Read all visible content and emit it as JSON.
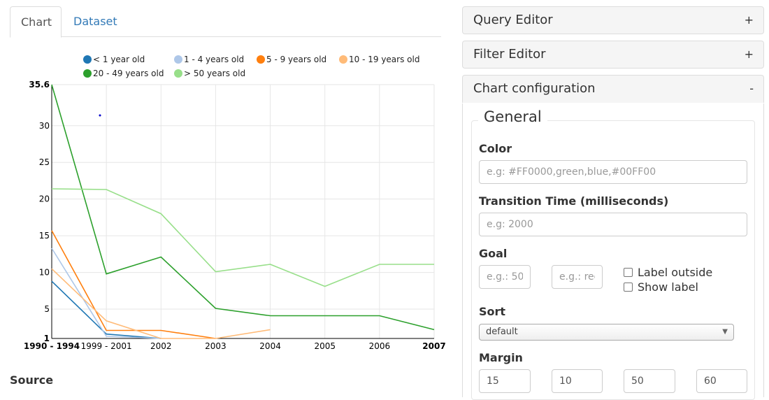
{
  "tabs": [
    {
      "label": "Chart",
      "active": true
    },
    {
      "label": "Dataset",
      "active": false
    }
  ],
  "source": {
    "title": "Source"
  },
  "panels": {
    "query_editor": {
      "title": "Query Editor",
      "toggle": "+"
    },
    "filter_editor": {
      "title": "Filter Editor",
      "toggle": "+"
    },
    "chart_configuration": {
      "title": "Chart configuration",
      "toggle": "-"
    }
  },
  "config": {
    "section_title": "General",
    "color": {
      "label": "Color",
      "placeholder": "e.g: #FF0000,green,blue,#00FF00",
      "value": ""
    },
    "transition": {
      "label": "Transition Time (milliseconds)",
      "placeholder": "e.g: 2000",
      "value": ""
    },
    "goal": {
      "label": "Goal",
      "value_placeholder": "e.g.: 50",
      "label_placeholder": "e.g.: red",
      "label_outside": "Label outside",
      "show_label": "Show label"
    },
    "sort": {
      "label": "Sort",
      "selected": "default"
    },
    "margin": {
      "label": "Margin",
      "values": [
        "15",
        "10",
        "50",
        "60"
      ]
    }
  },
  "chart_data": {
    "type": "line",
    "categories": [
      "1990 - 1994",
      "1999 - 2001",
      "2002",
      "2003",
      "2004",
      "2005",
      "2006",
      "2007"
    ],
    "ylim": [
      1,
      35.6
    ],
    "yticks": [
      1,
      5,
      10,
      15,
      20,
      25,
      30,
      35.6
    ],
    "ytick_labels": [
      "1",
      "5",
      "10",
      "15",
      "20",
      "25",
      "30",
      "35.6"
    ],
    "grid": true,
    "legend_position": "top",
    "series": [
      {
        "name": "< 1 year old",
        "color": "#1f77b4",
        "values": [
          8.8,
          1.6,
          1,
          null,
          null,
          null,
          null,
          null
        ]
      },
      {
        "name": "1 - 4 years old",
        "color": "#aec7e8",
        "values": [
          13.3,
          1.3,
          1,
          null,
          null,
          null,
          null,
          null
        ]
      },
      {
        "name": "5 - 9 years old",
        "color": "#ff7f0e",
        "values": [
          15.7,
          2.1,
          2.1,
          1,
          null,
          null,
          null,
          null
        ]
      },
      {
        "name": "10 - 19 years old",
        "color": "#ffbb78",
        "values": [
          10.5,
          3.4,
          1,
          1,
          2.2,
          null,
          null,
          null
        ]
      },
      {
        "name": "20 - 49 years old",
        "color": "#2ca02c",
        "values": [
          35.6,
          9.8,
          12.1,
          5.1,
          4.1,
          4.1,
          4.1,
          2.2
        ]
      },
      {
        "name": "> 50 years old",
        "color": "#98df8a",
        "values": [
          21.4,
          21.3,
          18.0,
          10.1,
          11.1,
          8.1,
          11.1,
          11.1
        ]
      }
    ]
  }
}
